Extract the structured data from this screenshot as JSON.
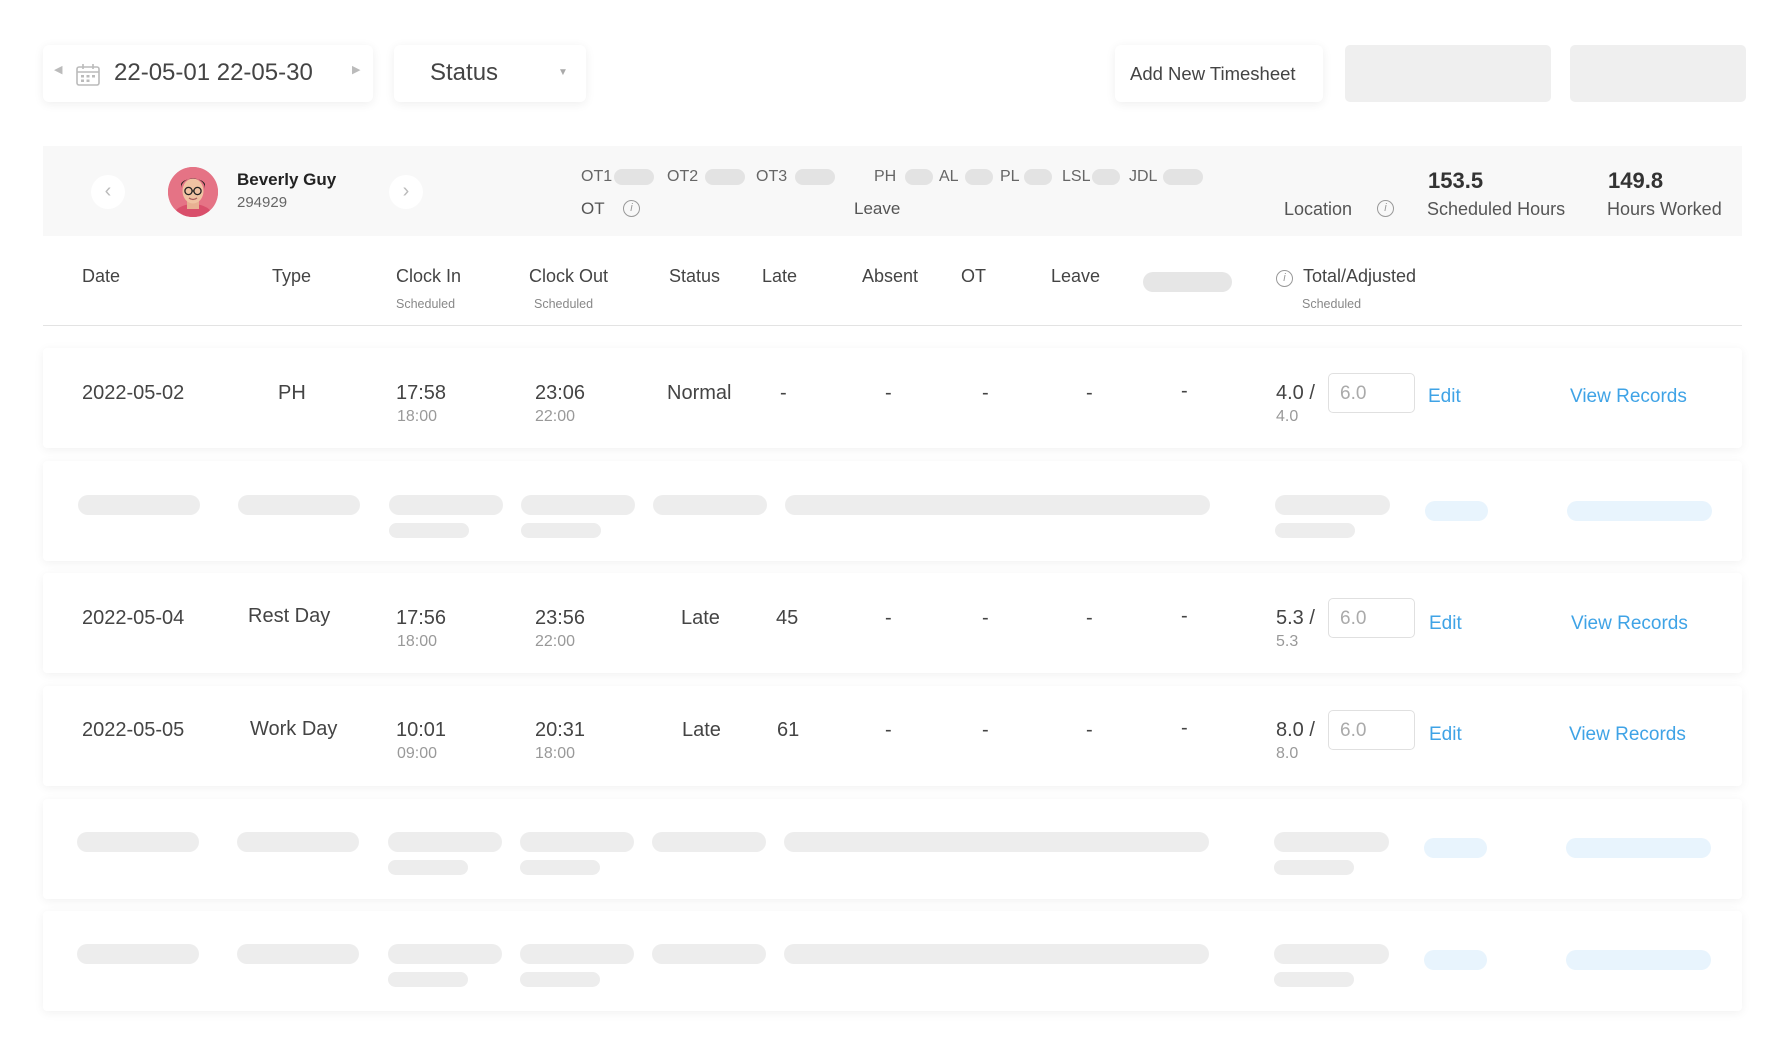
{
  "toolbar": {
    "date_range": "22-05-01 22-05-30",
    "status_label": "Status",
    "add_button_label": "Add New Timesheet"
  },
  "employee": {
    "name": "Beverly Guy",
    "id": "294929",
    "ot_labels": [
      "OT1",
      "OT2",
      "OT3"
    ],
    "ot_caption": "OT",
    "leave_labels": [
      "PH",
      "AL",
      "PL",
      "LSL",
      "JDL"
    ],
    "leave_caption": "Leave",
    "location_label": "Location",
    "scheduled_hours_value": "153.5",
    "scheduled_hours_label": "Scheduled Hours",
    "hours_worked_value": "149.8",
    "hours_worked_label": "Hours Worked"
  },
  "table": {
    "headers": {
      "date": "Date",
      "type": "Type",
      "clock_in": "Clock In",
      "clock_in_sub": "Scheduled",
      "clock_out": "Clock Out",
      "clock_out_sub": "Scheduled",
      "status": "Status",
      "late": "Late",
      "absent": "Absent",
      "ot": "OT",
      "leave": "Leave",
      "total": "Total/Adjusted",
      "total_sub": "Scheduled"
    },
    "rows": [
      {
        "date": "2022-05-02",
        "type": "PH",
        "clock_in": "17:58",
        "clock_in_sched": "18:00",
        "clock_out": "23:06",
        "clock_out_sched": "22:00",
        "status": "Normal",
        "late": "-",
        "absent": "-",
        "ot": "-",
        "leave": "-",
        "extra": "-",
        "total": "4.0 /",
        "total_sched": "4.0",
        "adjusted": "6.0",
        "edit": "Edit",
        "view": "View Records"
      },
      {
        "date": "2022-05-04",
        "type": "Rest Day",
        "clock_in": "17:56",
        "clock_in_sched": "18:00",
        "clock_out": "23:56",
        "clock_out_sched": "22:00",
        "status": "Late",
        "late": "45",
        "absent": "-",
        "ot": "-",
        "leave": "-",
        "extra": "-",
        "total": "5.3 /",
        "total_sched": "5.3",
        "adjusted": "6.0",
        "edit": "Edit",
        "view": "View Records"
      },
      {
        "date": "2022-05-05",
        "type": "Work Day",
        "clock_in": "10:01",
        "clock_in_sched": "09:00",
        "clock_out": "20:31",
        "clock_out_sched": "18:00",
        "status": "Late",
        "late": "61",
        "absent": "-",
        "ot": "-",
        "leave": "-",
        "extra": "-",
        "total": "8.0 /",
        "total_sched": "8.0",
        "adjusted": "6.0",
        "edit": "Edit",
        "view": "View Records"
      }
    ]
  },
  "icons": {
    "prev": "caret-left-icon",
    "next": "caret-right-icon",
    "calendar": "calendar-icon",
    "dropdown": "chevron-down-icon",
    "info": "info-icon"
  }
}
